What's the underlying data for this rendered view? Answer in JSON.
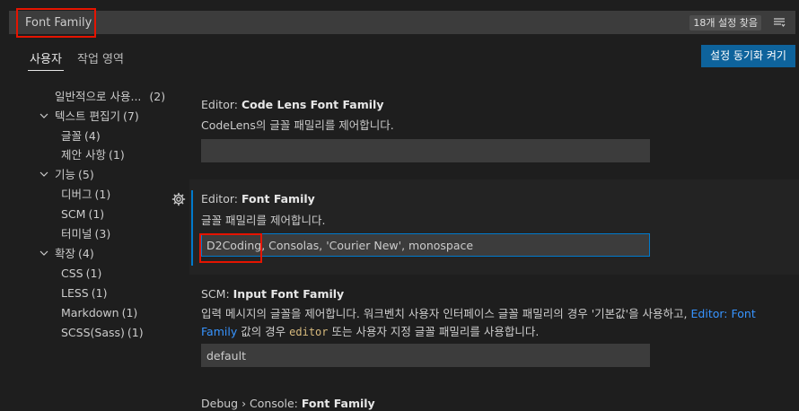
{
  "search": {
    "value": "Font Family",
    "result_count": "18개 설정 찾음"
  },
  "tabs": {
    "user": "사용자",
    "workspace": "작업 영역"
  },
  "sync_button": "설정 동기화 켜기",
  "toc": [
    {
      "label": "일반적으로 사용...",
      "count": "(2)",
      "level": 1,
      "expandable": false
    },
    {
      "label": "텍스트 편집기",
      "count": "(7)",
      "level": 0,
      "expandable": true
    },
    {
      "label": "글꼴",
      "count": "(4)",
      "level": 1,
      "expandable": false
    },
    {
      "label": "제안 사항",
      "count": "(1)",
      "level": 1,
      "expandable": false
    },
    {
      "label": "기능",
      "count": "(5)",
      "level": 0,
      "expandable": true
    },
    {
      "label": "디버그",
      "count": "(1)",
      "level": 1,
      "expandable": false
    },
    {
      "label": "SCM",
      "count": "(1)",
      "level": 1,
      "expandable": false
    },
    {
      "label": "터미널",
      "count": "(3)",
      "level": 1,
      "expandable": false
    },
    {
      "label": "확장",
      "count": "(4)",
      "level": 0,
      "expandable": true
    },
    {
      "label": "CSS",
      "count": "(1)",
      "level": 1,
      "expandable": false
    },
    {
      "label": "LESS",
      "count": "(1)",
      "level": 1,
      "expandable": false
    },
    {
      "label": "Markdown",
      "count": "(1)",
      "level": 1,
      "expandable": false
    },
    {
      "label": "SCSS(Sass)",
      "count": "(1)",
      "level": 1,
      "expandable": false
    }
  ],
  "settings": {
    "codelens": {
      "category": "Editor: ",
      "key": "Code Lens Font Family",
      "description": "CodeLens의 글꼴 패밀리를 제어합니다.",
      "value": ""
    },
    "font_family": {
      "category": "Editor: ",
      "key": "Font Family",
      "description": "글꼴 패밀리를 제어합니다.",
      "value": "D2Coding, Consolas, 'Courier New', monospace"
    },
    "scm": {
      "category": "SCM: ",
      "key": "Input Font Family",
      "desc_part1": "입력 메시지의 글꼴을 제어합니다. 워크벤치 사용자 인터페이스 글꼴 패밀리의 경우 '기본값'을 사용하고, ",
      "desc_link1": "Editor:",
      "desc_link2": "Font Family",
      "desc_part2": " 값의 경우 ",
      "desc_code": "editor",
      "desc_part3": " 또는 사용자 지정 글꼴 패밀리를 사용합니다.",
      "value": "default"
    },
    "debug": {
      "category": "Debug › Console: ",
      "key": "Font Family"
    }
  },
  "colors": {
    "background": "#1e1e1e",
    "input": "#3c3c3c",
    "accent": "#007acc",
    "button": "#0e639c",
    "highlight": "#e51400",
    "link": "#3794ff"
  }
}
